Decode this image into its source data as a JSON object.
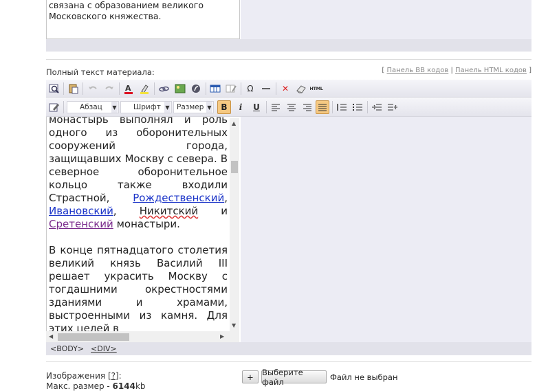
{
  "top_text": {
    "lines": [
      "связана с образованием великого",
      "Московского княжества."
    ]
  },
  "full_text": {
    "label": "Полный текст материала:",
    "bracket_open": "[",
    "bb_link": "Панель BB кодов",
    "separator": "|",
    "html_link": "Панель HTML кодов",
    "bracket_close": "]"
  },
  "toolbar": {
    "row1": [
      "preview-icon",
      "paste-icon",
      "undo-icon",
      "redo-icon",
      "text-color-icon",
      "highlight-icon",
      "link-icon",
      "image-icon",
      "flash-icon",
      "table-icon",
      "table-props-icon",
      "special-char-icon",
      "horizontal-rule-icon",
      "remove-format-icon",
      "clean-icon",
      "html-source-icon"
    ],
    "format_select": "Абзац",
    "font_select": "Шрифт",
    "size_select": "Размер",
    "bold": "B",
    "italic": "i",
    "underline": "U",
    "html_label": "HTML",
    "omega": "Ω",
    "cross": "✕"
  },
  "editor": {
    "p1": {
      "l1": "монастырь выполнял и роль",
      "l2": "одного из оборонительных",
      "l3": "сооружений города,",
      "l4": "защищавших Москву с севера.",
      "l5": "В северное оборонительное",
      "l6": "кольцо также входили",
      "l7a": "Страстной,",
      "link1": "Рождественский",
      "comma1": ",",
      "link2": "Ивановский",
      "comma2": ",",
      "nikit": "Никитский",
      "and": "и",
      "link3": "Сретенский",
      "end": "монастыри."
    },
    "p2": {
      "l1": "В конце пятнадцатого",
      "l2": "столетия великий князь",
      "l3": "Василий III решает украсить",
      "l4": "Москву с тогдашними",
      "l5": "окрестностями зданиями и",
      "l6": "храмами, выстроенными из",
      "l7": "камня. Для этих целей в"
    }
  },
  "status": {
    "body_tag": "<BODY>",
    "div_tag": "<DIV>"
  },
  "images": {
    "label": "Изображения [",
    "help": "?",
    "label_end": "]:",
    "max_size_label": "Макс. размер - ",
    "max_size_value": "6144",
    "max_size_unit": "kb",
    "add_button": "+",
    "choose_button": "Выберите файл",
    "no_file": "Файл не выбран"
  },
  "colors": {
    "active_button": "#f6c982",
    "link": "#1a33c8",
    "visited_link": "#7a2a8c",
    "panel_bg": "#ececf4"
  }
}
